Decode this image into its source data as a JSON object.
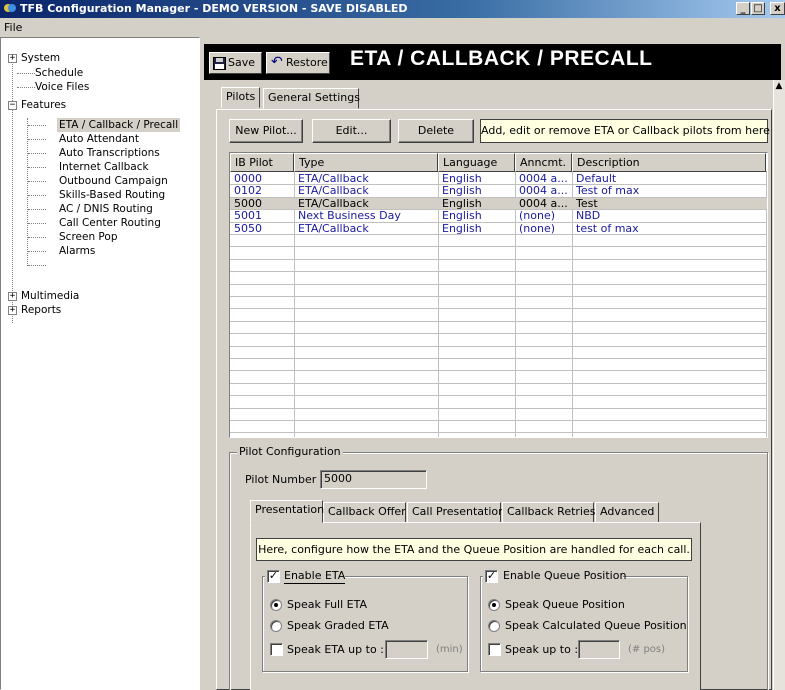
{
  "window": {
    "title": "TFB Configuration Manager - DEMO VERSION - SAVE DISABLED",
    "min_btn": "_",
    "max_btn": "□",
    "close_btn": "x"
  },
  "menu": {
    "file": "File"
  },
  "tree": {
    "system": "System",
    "schedule": "Schedule",
    "voice_files": "Voice Files",
    "features": "Features",
    "features_children": [
      "ETA / Callback / Precall",
      "Auto Attendant",
      "Auto Transcriptions",
      "Internet Callback",
      "Outbound Campaign",
      "Skills-Based Routing",
      "AC / DNIS Routing",
      "Call Center Routing",
      "Screen Pop",
      "Alarms"
    ],
    "multimedia": "Multimedia",
    "reports": "Reports",
    "collapsed_glyph": "+",
    "expanded_glyph": "−"
  },
  "toolbar": {
    "save": "Save",
    "restore": "Restore",
    "banner": "ETA / CALLBACK / PRECALL"
  },
  "tabs": {
    "pilots": "Pilots",
    "general": "General Settings"
  },
  "pilot_buttons": {
    "new": "New Pilot...",
    "edit": "Edit...",
    "delete": "Delete"
  },
  "pilot_hint": "Add, edit or remove ETA or Callback pilots from here",
  "grid": {
    "headers": [
      "IB Pilot",
      "Type",
      "Language",
      "Anncmt.",
      "Description"
    ],
    "rows": [
      [
        "0000",
        "ETA/Callback",
        "English",
        "0004 a...",
        "Default"
      ],
      [
        "0102",
        "ETA/Callback",
        "English",
        "0004 a...",
        "Test of max"
      ],
      [
        "5000",
        "ETA/Callback",
        "English",
        "0004 a...",
        "Test"
      ],
      [
        "5001",
        "Next Business Day",
        "English",
        "(none)",
        "NBD"
      ],
      [
        "5050",
        "ETA/Callback",
        "English",
        "(none)",
        "test of max"
      ]
    ],
    "selected_row": 2
  },
  "pilot_config": {
    "group_label": "Pilot Configuration",
    "pilot_number_label": "Pilot Number :",
    "pilot_number": "5000"
  },
  "config_tabs": [
    "Presentation",
    "Callback Offer",
    "Call Presentation",
    "Callback Retries",
    "Advanced"
  ],
  "presentation": {
    "hint": "Here, configure how the ETA and the Queue Position are handled for each call.",
    "check_glyph": "✓",
    "eta": {
      "title": "Enable ETA",
      "enabled": true,
      "speak_full": "Speak Full ETA",
      "speak_graded": "Speak Graded ETA",
      "speak_up_to": "Speak ETA up to :",
      "unit": "(min)"
    },
    "queue": {
      "title": "Enable Queue Position",
      "enabled": true,
      "speak_queue": "Speak Queue Position",
      "speak_calculated": "Speak Calculated Queue Position",
      "speak_up_to": "Speak up to :",
      "unit": "(# pos)"
    }
  },
  "colors": {
    "title_bar": "#0a246a",
    "grid_text": "#1a1aa0",
    "hint_bg": "#ffffe1"
  }
}
